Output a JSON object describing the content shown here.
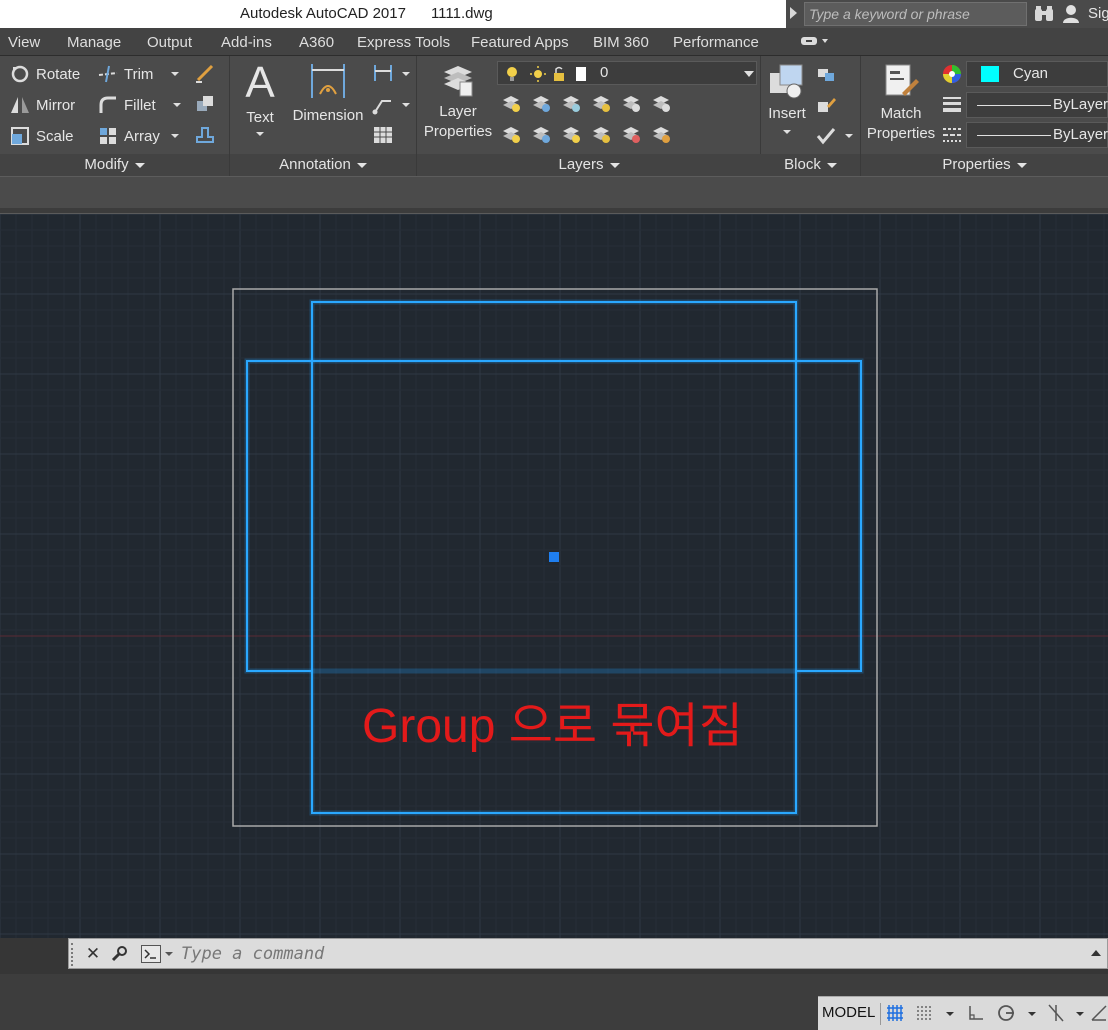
{
  "titlebar": {
    "title": "Autodesk AutoCAD 2017      1111.dwg",
    "search_placeholder": "Type a keyword or phrase",
    "signin": "Sig"
  },
  "menu": {
    "tabs": [
      "View",
      "Manage",
      "Output",
      "Add-ins",
      "A360",
      "Express Tools",
      "Featured Apps",
      "BIM 360",
      "Performance"
    ]
  },
  "ribbon": {
    "modify": {
      "title": "Modify",
      "rotate": "Rotate",
      "mirror": "Mirror",
      "scale": "Scale",
      "trim": "Trim",
      "fillet": "Fillet",
      "array": "Array"
    },
    "annotation": {
      "title": "Annotation",
      "text": "Text",
      "dimension": "Dimension"
    },
    "layers": {
      "title": "Layers",
      "layer_properties_line1": "Layer",
      "layer_properties_line2": "Properties",
      "current_layer": "0"
    },
    "block": {
      "title": "Block",
      "insert": "Insert"
    },
    "properties": {
      "title": "Properties",
      "match_line1": "Match",
      "match_line2": "Properties",
      "color": "Cyan",
      "color_hex": "#00ffff",
      "linetype": "ByLayer",
      "lineweight": "ByLayer"
    }
  },
  "drawing": {
    "annotation_text": "Group 으로 묶여짐",
    "annotation_color": "#e31a1a",
    "entity_color": "#1fa0ff"
  },
  "command": {
    "placeholder": "Type a command"
  },
  "status": {
    "model": "MODEL"
  }
}
